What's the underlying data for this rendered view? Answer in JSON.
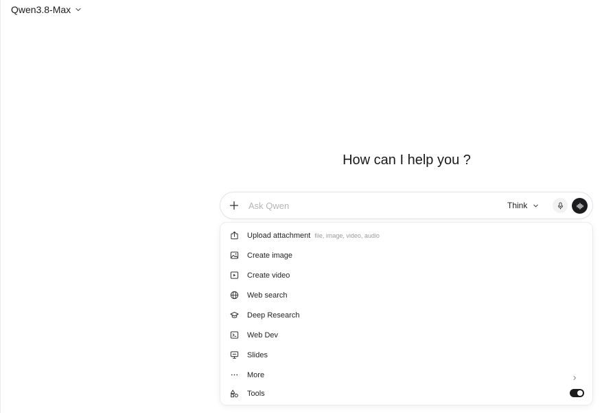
{
  "header": {
    "model_name": "Qwen3.8-Max"
  },
  "main": {
    "greeting": "How can I help you ?"
  },
  "composer": {
    "placeholder": "Ask Qwen",
    "value": "",
    "mode_label": "Think"
  },
  "menu": {
    "items": [
      {
        "label": "Upload attachment",
        "hint": "file, image, video, audio",
        "icon": "upload-icon"
      },
      {
        "label": "Create image",
        "icon": "image-icon"
      },
      {
        "label": "Create video",
        "icon": "video-icon"
      },
      {
        "label": "Web search",
        "icon": "globe-icon"
      },
      {
        "label": "Deep Research",
        "icon": "graduation-cap-icon"
      },
      {
        "label": "Web Dev",
        "icon": "terminal-icon"
      },
      {
        "label": "Slides",
        "icon": "presentation-icon"
      },
      {
        "label": "More",
        "icon": "ellipsis-icon"
      },
      {
        "label": "Tools",
        "icon": "shapes-icon"
      }
    ],
    "tools_enabled": true
  },
  "colors": {
    "accent_dark": "#1c1c1e",
    "border": "#e4e4e7",
    "muted_text": "#9a9a9a"
  }
}
